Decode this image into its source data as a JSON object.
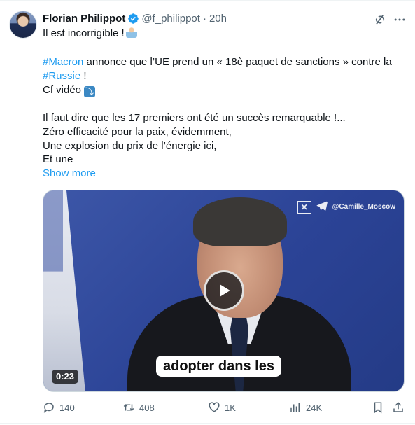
{
  "author": {
    "name": "Florian Philippot",
    "handle": "@f_philippot",
    "separator": "·",
    "time": "20h",
    "verified_icon": "verified-badge-icon",
    "verified_color": "#1d9bf0"
  },
  "post": {
    "line1": "Il est incorrigible !",
    "line2_hashtag": "#Macron",
    "line2_rest": " annonce que l’UE prend un « 18è paquet de sanctions » contre la",
    "line3_hashtag": "#Russie",
    "line3_rest": " !",
    "line4": "Cf vidéo",
    "line5": "Il faut dire que les 17 premiers ont été un succès remarquable !...",
    "line6": "Zéro efficacité pour la paix, évidemment,",
    "line7": "Une explosion du prix de l’énergie ici,",
    "line8": "Et une",
    "show_more": "Show more",
    "emoji1": "person-facepalm-emoji",
    "emoji2": "arrow-down-right-emoji"
  },
  "media": {
    "watermark": "@Camille_Moscow",
    "caption": "adopter dans les",
    "duration": "0:23",
    "play_icon": "play-icon"
  },
  "actions": {
    "replies": "140",
    "reposts": "408",
    "likes": "1K",
    "views": "24K"
  },
  "colors": {
    "accent": "#1d9bf0",
    "text": "#0f1419",
    "muted": "#536471"
  }
}
